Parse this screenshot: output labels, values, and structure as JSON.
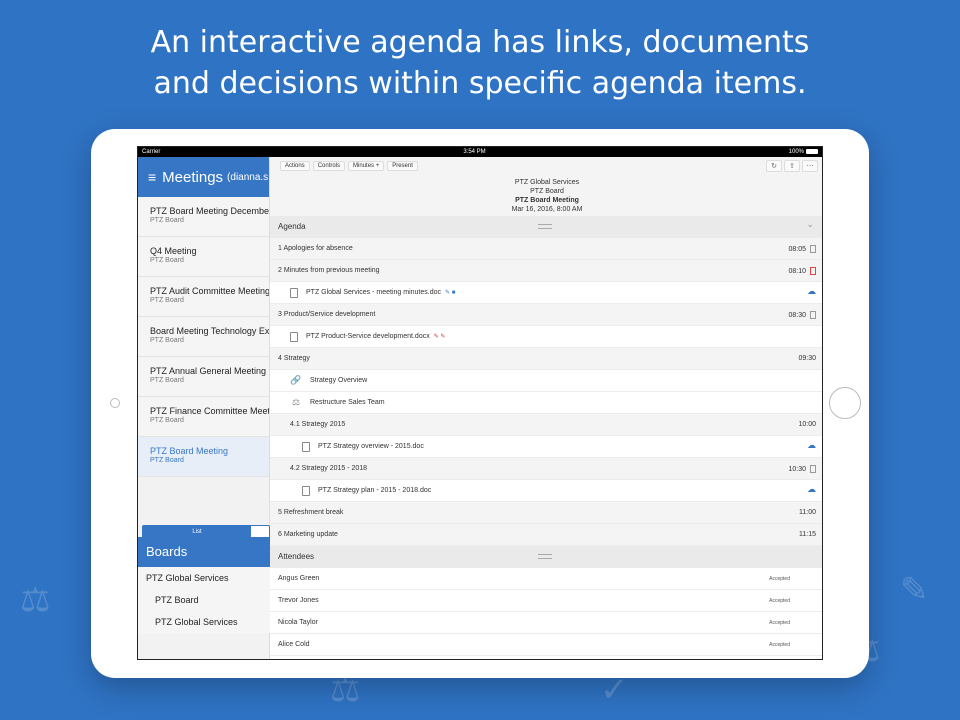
{
  "headline": {
    "line1": "An interactive agenda has links, documents",
    "line2": "and decisions within specific agenda items."
  },
  "status_bar": {
    "carrier": "Carrier",
    "time": "3:54 PM",
    "battery": "100%"
  },
  "sidebar": {
    "title": "Meetings",
    "user": "(dianna.s",
    "meetings": [
      {
        "name": "PTZ Board Meeting December",
        "board": "PTZ Board"
      },
      {
        "name": "Q4 Meeting",
        "board": "PTZ Board"
      },
      {
        "name": "PTZ Audit Committee Meeting",
        "board": "PTZ Board"
      },
      {
        "name": "Board Meeting Technology Ex",
        "board": "PTZ Board"
      },
      {
        "name": "PTZ Annual General Meeting",
        "board": "PTZ Board"
      },
      {
        "name": "PTZ Finance Committee Meet",
        "board": "PTZ Board"
      },
      {
        "name": "PTZ Board Meeting",
        "board": "PTZ Board"
      }
    ],
    "segment": {
      "list": "List"
    },
    "boards_title": "Boards",
    "boards": [
      "PTZ Global Services",
      "PTZ Board",
      "PTZ Global Services"
    ]
  },
  "toolbar": {
    "actions": "Actions",
    "controls": "Controls",
    "minutes": "Minutes +",
    "present": "Present"
  },
  "meeting": {
    "org": "PTZ Global Services",
    "board": "PTZ Board",
    "title": "PTZ Board Meeting",
    "date": "Mar 16, 2016, 8:00 AM"
  },
  "agenda": {
    "title": "Agenda",
    "rows": {
      "r1": {
        "label": "1 Apologies for absence",
        "time": "08:05"
      },
      "r2": {
        "label": "2 Minutes from previous meeting",
        "time": "08:10"
      },
      "r2doc": {
        "label": "PTZ Global Services - meeting minutes.doc"
      },
      "r3": {
        "label": "3 Product/Service development",
        "time": "08:30"
      },
      "r3doc": {
        "label": "PTZ Product-Service development.docx"
      },
      "r4": {
        "label": "4 Strategy",
        "time": "09:30"
      },
      "r4link": {
        "label": "Strategy Overview"
      },
      "r4dec": {
        "label": "Restructure Sales Team"
      },
      "r41": {
        "label": "4.1 Strategy 2015",
        "time": "10:00"
      },
      "r41doc": {
        "label": "PTZ Strategy overview - 2015.doc"
      },
      "r42": {
        "label": "4.2 Strategy 2015 - 2018",
        "time": "10:30"
      },
      "r42doc": {
        "label": "PTZ Strategy plan - 2015 - 2018.doc"
      },
      "r5": {
        "label": "5 Refreshment break",
        "time": "11:00"
      },
      "r6": {
        "label": "6 Marketing update",
        "time": "11:15"
      }
    }
  },
  "attendees": {
    "title": "Attendees",
    "rows": [
      {
        "name": "Angus Green",
        "status": "Accepted"
      },
      {
        "name": "Trevor Jones",
        "status": "Accepted"
      },
      {
        "name": "Nicola Taylor",
        "status": "Accepted"
      },
      {
        "name": "Alice Cold",
        "status": "Accepted"
      }
    ]
  },
  "icons": [
    "menu-icon",
    "refresh-icon",
    "share-icon",
    "more-icon",
    "document-icon",
    "link-icon",
    "gavel-icon",
    "cloud-download-icon"
  ]
}
